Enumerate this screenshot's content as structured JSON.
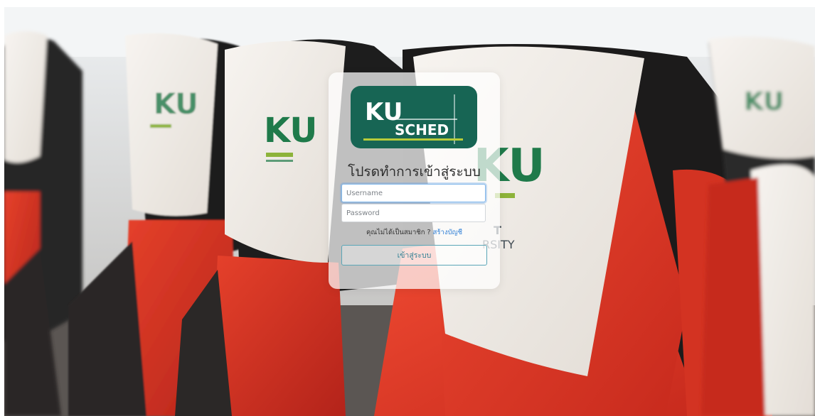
{
  "logo": {
    "line1": "KU",
    "line2": "SCHED",
    "bg_color": "#176554",
    "accent_color": "#b8cc3a"
  },
  "login": {
    "heading": "โปรดทำการเข้าสู่ระบบ",
    "username_placeholder": "Username",
    "password_placeholder": "Password",
    "signup_prompt": "คุณไม่ได้เป็นสมาชิก ? ",
    "signup_link": "สร้างบัญชี",
    "submit_label": "เข้าสู่ระบบ"
  },
  "background": {
    "description_colors": {
      "seat_red": "#d8321f",
      "headrest_white": "#f2eeea",
      "ku_green": "#1f7a4a"
    }
  }
}
